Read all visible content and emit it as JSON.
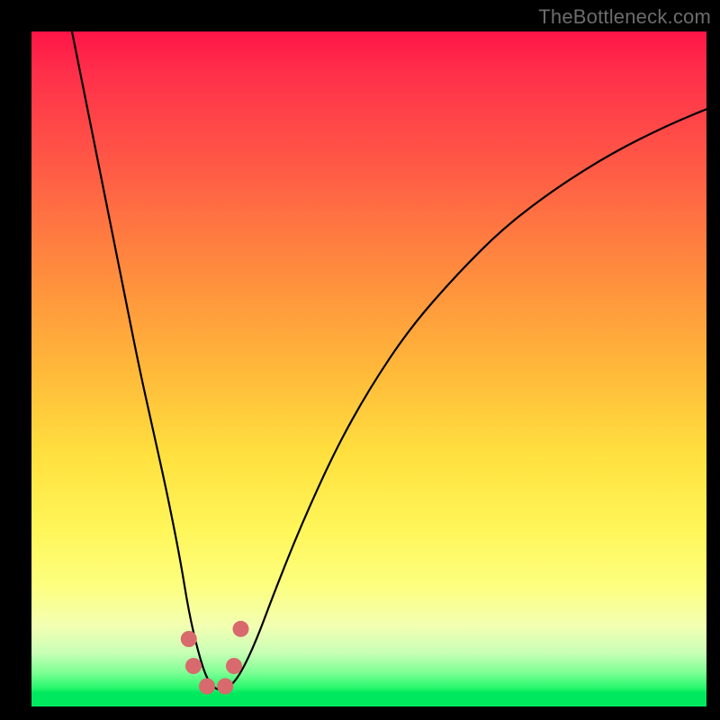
{
  "watermark": "TheBottleneck.com",
  "colors": {
    "frame": "#000000",
    "gradient_top": "#ff1547",
    "gradient_mid": "#ffe13f",
    "gradient_bottom": "#00e85e",
    "curve": "#000000",
    "marker": "#d86a6d"
  },
  "chart_data": {
    "type": "line",
    "title": "",
    "xlabel": "",
    "ylabel": "",
    "xlim": [
      0,
      100
    ],
    "ylim": [
      0,
      100
    ],
    "grid": false,
    "legend": false,
    "series": [
      {
        "name": "bottleneck-curve",
        "x": [
          6,
          8,
          10,
          12,
          14,
          16,
          18,
          20,
          22,
          23.3,
          24.7,
          26,
          27.3,
          28.7,
          30.5,
          33,
          36,
          40,
          45,
          50,
          56,
          63,
          70,
          78,
          86,
          94,
          100
        ],
        "y": [
          100,
          90,
          80,
          70,
          60,
          50,
          41,
          32,
          22,
          14,
          8,
          4,
          2.5,
          2.5,
          4,
          9,
          17,
          27,
          38,
          47,
          56,
          64,
          71,
          77,
          82,
          86,
          88.5
        ]
      }
    ],
    "markers": [
      {
        "name": "left-shoulder-top",
        "x": 23.3,
        "y": 10.0
      },
      {
        "name": "left-shoulder-bottom",
        "x": 24.0,
        "y": 6.0
      },
      {
        "name": "trough-left",
        "x": 26.0,
        "y": 3.0
      },
      {
        "name": "trough-right",
        "x": 28.7,
        "y": 3.0
      },
      {
        "name": "right-shoulder-bottom",
        "x": 30.0,
        "y": 6.0
      },
      {
        "name": "right-shoulder-top",
        "x": 31.0,
        "y": 11.5
      }
    ],
    "marker_radius_px": 9
  }
}
